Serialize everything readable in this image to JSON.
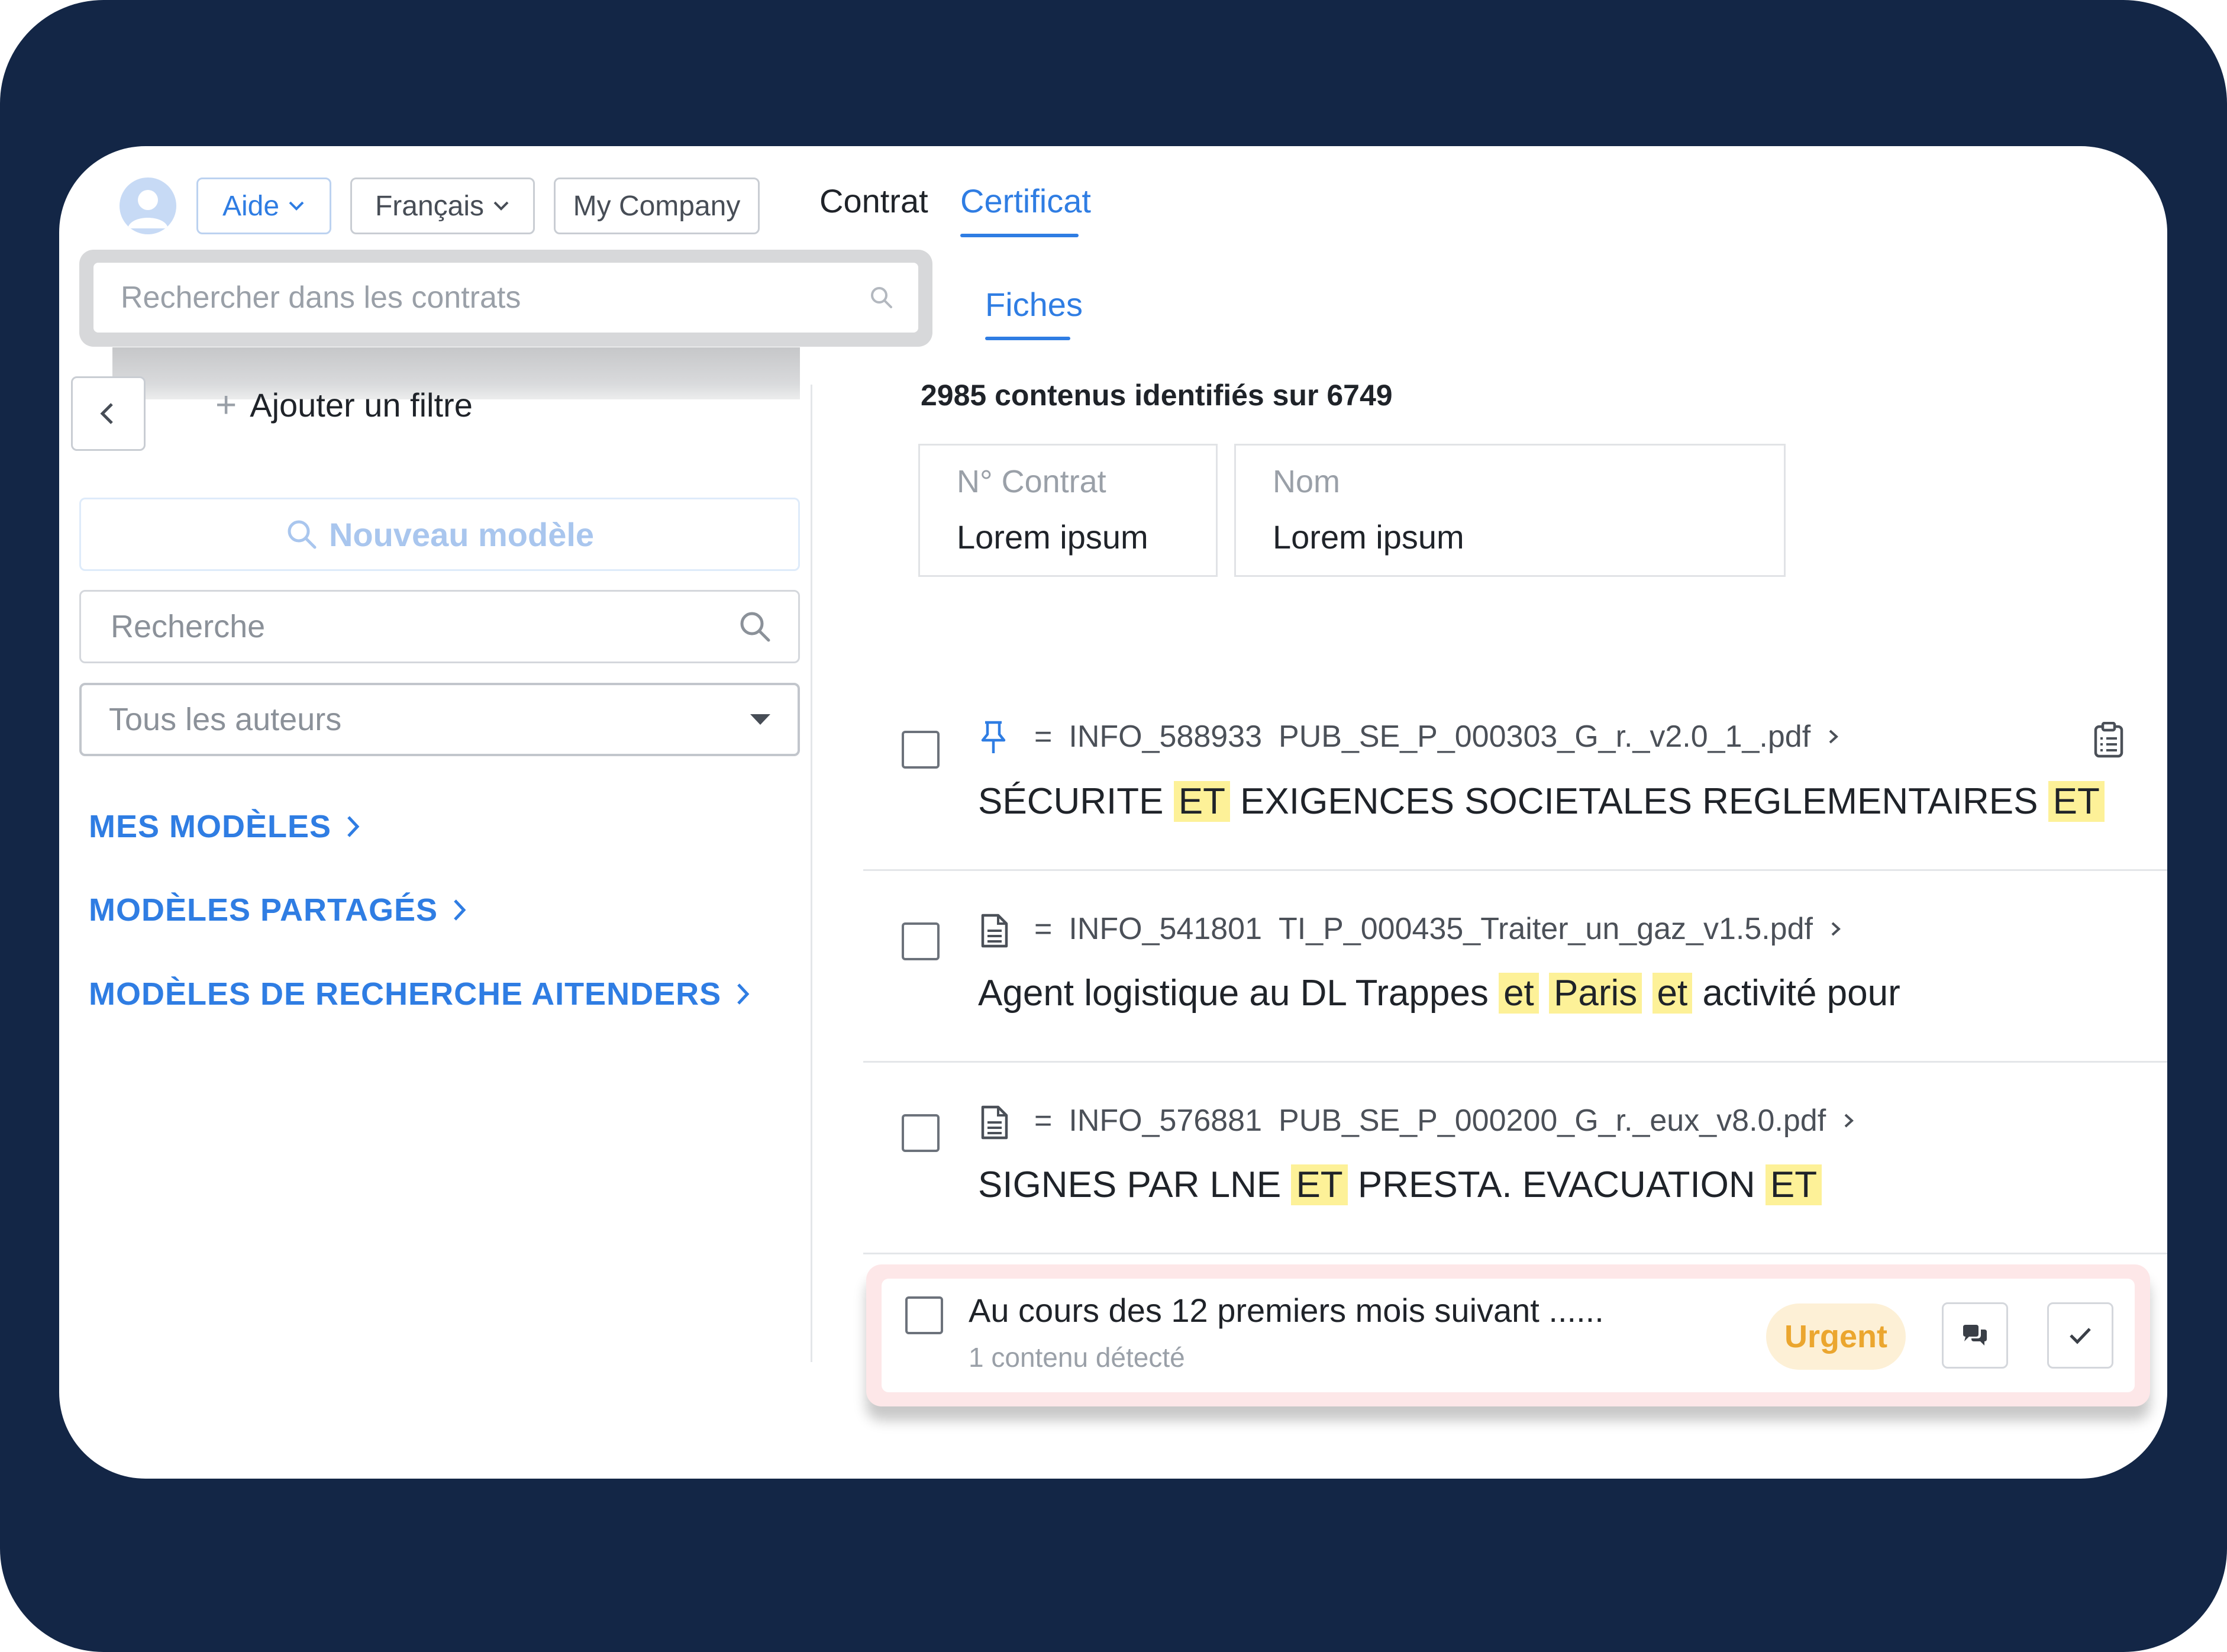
{
  "header": {
    "aide_label": "Aide",
    "langue_label": "Français",
    "company_label": "My Company",
    "tabs": [
      {
        "label": "Contrat",
        "active": false
      },
      {
        "label": "Certificat",
        "active": true
      }
    ],
    "subtab_label": "Fiches"
  },
  "sidebar": {
    "search_placeholder": "Rechercher dans les contrats",
    "add_filter_label": "Ajouter un filtre",
    "new_model_label": "Nouveau modèle",
    "recherche_placeholder": "Recherche",
    "auteurs_label": "Tous les auteurs",
    "links": [
      {
        "label": "MES MODÈLES"
      },
      {
        "label": "MODÈLES PARTAGÉS"
      },
      {
        "label": "MODÈLES DE RECHERCHE AITENDERS"
      }
    ]
  },
  "main": {
    "count_text": "2985 contenus identifiés sur 6749",
    "fields": [
      {
        "label": "N° Contrat",
        "value": "Lorem ipsum"
      },
      {
        "label": "Nom",
        "value": "Lorem ipsum"
      }
    ],
    "results": [
      {
        "icon": "pin-icon",
        "eq": "=",
        "id": "INFO_588933",
        "file": "PUB_SE_P_000303_G_r._v2.0_1_.pdf",
        "snippet": [
          {
            "t": "SÉCURITE ",
            "hl": false
          },
          {
            "t": "ET",
            "hl": true
          },
          {
            "t": " EXIGENCES SOCIETALES REGLEMENTAIRES ",
            "hl": false
          },
          {
            "t": "ET",
            "hl": true
          }
        ]
      },
      {
        "icon": "document-icon",
        "eq": "=",
        "id": "INFO_541801",
        "file": "TI_P_000435_Traiter_un_gaz_v1.5.pdf",
        "snippet": [
          {
            "t": "Agent logistique au DL Trappes ",
            "hl": false
          },
          {
            "t": "et",
            "hl": true
          },
          {
            "t": " ",
            "hl": false
          },
          {
            "t": "Paris",
            "hl": true
          },
          {
            "t": " ",
            "hl": false
          },
          {
            "t": "et",
            "hl": true
          },
          {
            "t": " activité pour",
            "hl": false
          }
        ]
      },
      {
        "icon": "document-icon",
        "eq": "=",
        "id": "INFO_576881",
        "file": "PUB_SE_P_000200_G_r._eux_v8.0.pdf",
        "snippet": [
          {
            "t": "SIGNES PAR LNE ",
            "hl": false
          },
          {
            "t": "ET",
            "hl": true
          },
          {
            "t": " PRESTA. EVACUATION ",
            "hl": false
          },
          {
            "t": "ET",
            "hl": true
          }
        ]
      }
    ],
    "alert": {
      "title": "Au cours des 12 premiers mois suivant ......",
      "sub": "1 contenu détecté",
      "badge": "Urgent"
    }
  },
  "colors": {
    "frame": "#132646",
    "accent": "#2f7de3",
    "highlight": "#fdf198",
    "urgent": "#eba62f"
  }
}
